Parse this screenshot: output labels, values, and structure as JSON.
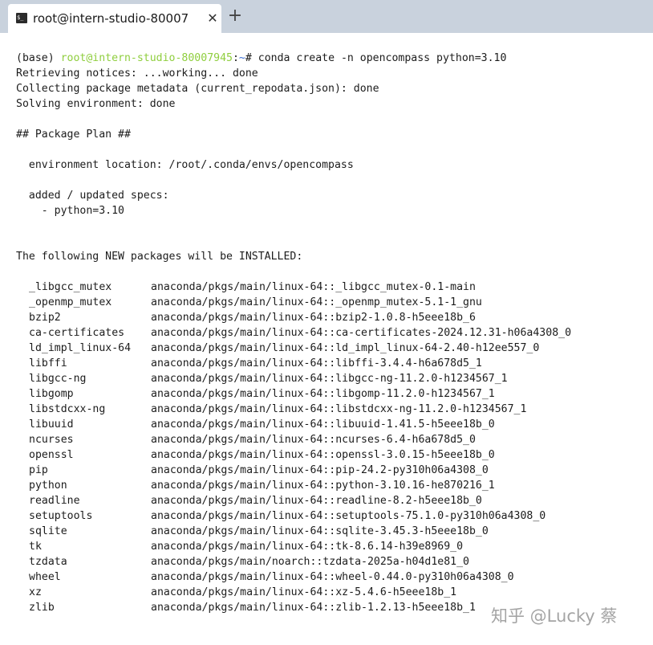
{
  "tab": {
    "title": "root@intern-studio-80007",
    "close_glyph": "✕",
    "new_tab_glyph": "+",
    "icon_glyph": "$_"
  },
  "prompt": {
    "env": "(base) ",
    "user_host": "root@intern-studio-80007945",
    "colon": ":",
    "path": "~",
    "symbol": "# ",
    "command": "conda create -n opencompass python=3.10"
  },
  "output_lines": [
    "Retrieving notices: ...working... done",
    "Collecting package metadata (current_repodata.json): done",
    "Solving environment: done",
    "",
    "## Package Plan ##",
    "",
    "  environment location: /root/.conda/envs/opencompass",
    "",
    "  added / updated specs:",
    "    - python=3.10",
    "",
    "",
    "The following NEW packages will be INSTALLED:"
  ],
  "packages": [
    {
      "name": "_libgcc_mutex",
      "source": "anaconda/pkgs/main/linux-64::_libgcc_mutex-0.1-main"
    },
    {
      "name": "_openmp_mutex",
      "source": "anaconda/pkgs/main/linux-64::_openmp_mutex-5.1-1_gnu"
    },
    {
      "name": "bzip2",
      "source": "anaconda/pkgs/main/linux-64::bzip2-1.0.8-h5eee18b_6"
    },
    {
      "name": "ca-certificates",
      "source": "anaconda/pkgs/main/linux-64::ca-certificates-2024.12.31-h06a4308_0"
    },
    {
      "name": "ld_impl_linux-64",
      "source": "anaconda/pkgs/main/linux-64::ld_impl_linux-64-2.40-h12ee557_0"
    },
    {
      "name": "libffi",
      "source": "anaconda/pkgs/main/linux-64::libffi-3.4.4-h6a678d5_1"
    },
    {
      "name": "libgcc-ng",
      "source": "anaconda/pkgs/main/linux-64::libgcc-ng-11.2.0-h1234567_1"
    },
    {
      "name": "libgomp",
      "source": "anaconda/pkgs/main/linux-64::libgomp-11.2.0-h1234567_1"
    },
    {
      "name": "libstdcxx-ng",
      "source": "anaconda/pkgs/main/linux-64::libstdcxx-ng-11.2.0-h1234567_1"
    },
    {
      "name": "libuuid",
      "source": "anaconda/pkgs/main/linux-64::libuuid-1.41.5-h5eee18b_0"
    },
    {
      "name": "ncurses",
      "source": "anaconda/pkgs/main/linux-64::ncurses-6.4-h6a678d5_0"
    },
    {
      "name": "openssl",
      "source": "anaconda/pkgs/main/linux-64::openssl-3.0.15-h5eee18b_0"
    },
    {
      "name": "pip",
      "source": "anaconda/pkgs/main/linux-64::pip-24.2-py310h06a4308_0"
    },
    {
      "name": "python",
      "source": "anaconda/pkgs/main/linux-64::python-3.10.16-he870216_1"
    },
    {
      "name": "readline",
      "source": "anaconda/pkgs/main/linux-64::readline-8.2-h5eee18b_0"
    },
    {
      "name": "setuptools",
      "source": "anaconda/pkgs/main/linux-64::setuptools-75.1.0-py310h06a4308_0"
    },
    {
      "name": "sqlite",
      "source": "anaconda/pkgs/main/linux-64::sqlite-3.45.3-h5eee18b_0"
    },
    {
      "name": "tk",
      "source": "anaconda/pkgs/main/linux-64::tk-8.6.14-h39e8969_0"
    },
    {
      "name": "tzdata",
      "source": "anaconda/pkgs/main/noarch::tzdata-2025a-h04d1e81_0"
    },
    {
      "name": "wheel",
      "source": "anaconda/pkgs/main/linux-64::wheel-0.44.0-py310h06a4308_0"
    },
    {
      "name": "xz",
      "source": "anaconda/pkgs/main/linux-64::xz-5.4.6-h5eee18b_1"
    },
    {
      "name": "zlib",
      "source": "anaconda/pkgs/main/linux-64::zlib-1.2.13-h5eee18b_1"
    }
  ],
  "watermark": "知乎 @Lucky 蔡",
  "colors": {
    "tabbar_bg": "#c9d2dd",
    "prompt_user_host": "#8fce3e",
    "prompt_path": "#3b6fd6",
    "text": "#1c1c1c"
  }
}
